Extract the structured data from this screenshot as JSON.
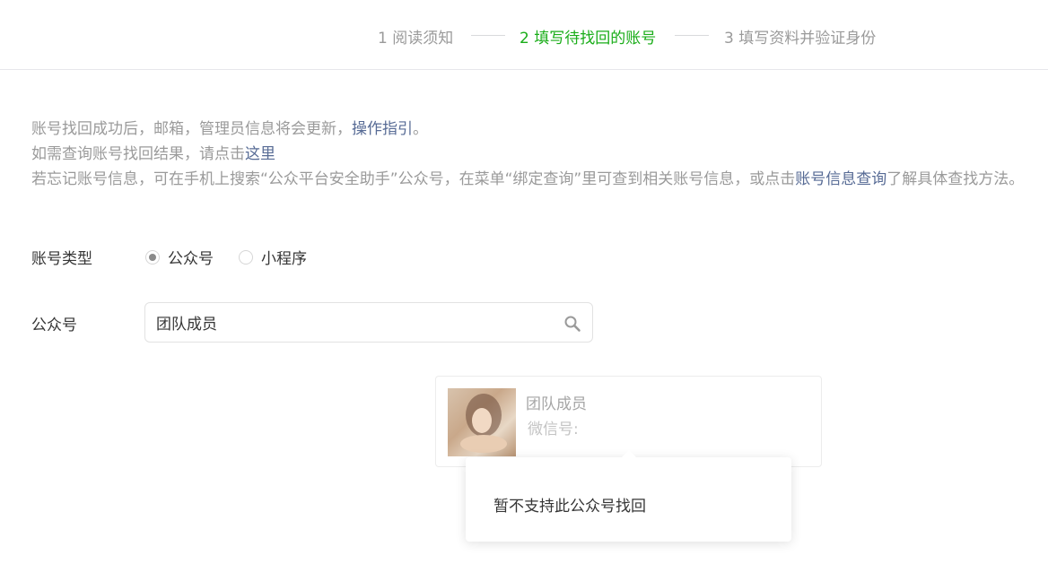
{
  "steps": [
    {
      "label": "1 阅读须知"
    },
    {
      "label": "2 填写待找回的账号"
    },
    {
      "label": "3 填写资料并验证身份"
    }
  ],
  "notice": {
    "line1_text": "账号找回成功后，邮箱，管理员信息将会更新，",
    "line1_link": "操作指引",
    "line1_end": "。",
    "line2_text": "如需查询账号找回结果，请点击",
    "line2_link": "这里",
    "line3_text": "若忘记账号信息，可在手机上搜索“公众平台安全助手”公众号，在菜单“绑定查询”里可查到相关账号信息，或点击",
    "line3_link": "账号信息查询",
    "line3_end": "了解具体查找方法。"
  },
  "account_type": {
    "label": "账号类型",
    "options": [
      {
        "label": "公众号",
        "checked": true
      },
      {
        "label": "小程序",
        "checked": false
      }
    ]
  },
  "search": {
    "label": "公众号",
    "value": "团队成员",
    "icon": "search-icon"
  },
  "result": {
    "name": "团队成员",
    "wechat_id_label": "微信号:",
    "wechat_id_value": ""
  },
  "popover": {
    "text": "暂不支持此公众号找回"
  },
  "colors": {
    "accent": "#1aad19",
    "link": "#576b95",
    "muted": "#9a9a9a"
  }
}
